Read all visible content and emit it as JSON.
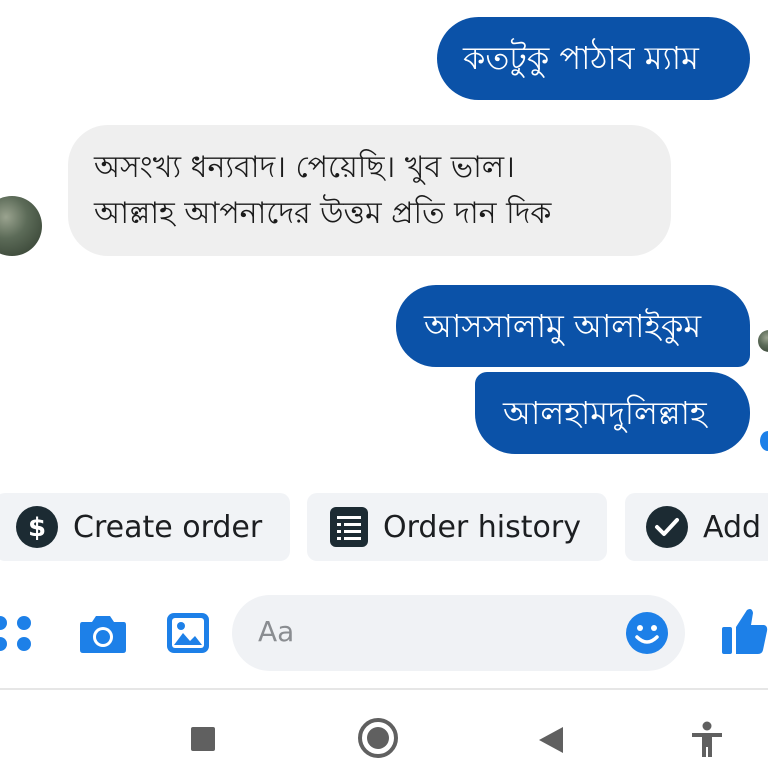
{
  "messages": [
    {
      "id": "m1",
      "side": "outgoing",
      "text": "কতটুকু পাঠাব ম্যাম"
    },
    {
      "id": "m2",
      "side": "incoming",
      "lines": [
        "অসংখ্য ধন্যবাদ। পেয়েছি। খুব ভাল।",
        "আল্লাহ আপনাদের উত্তম প্রতি দান  দিক"
      ]
    },
    {
      "id": "m3",
      "side": "outgoing",
      "text": "আসসালামু আলাইকুম"
    },
    {
      "id": "m4",
      "side": "outgoing",
      "text": "আলহামদুলিল্লাহ"
    }
  ],
  "quick_actions": [
    {
      "label": "Create order",
      "icon": "dollar-circle-icon"
    },
    {
      "label": "Order history",
      "icon": "document-list-icon"
    },
    {
      "label": "Add",
      "icon": "check-circle-icon"
    }
  ],
  "composer": {
    "placeholder": "Aa",
    "tools": [
      "apps-grid-icon",
      "camera-icon",
      "gallery-icon"
    ],
    "emoji_icon": "emoji-icon",
    "send_icon": "thumbs-up-icon"
  },
  "nav_bar": [
    "recents-square-icon",
    "home-circle-icon",
    "back-triangle-icon",
    "accessibility-icon"
  ],
  "colors": {
    "outgoing_bubble": "#0b52a8",
    "incoming_bubble": "#efefef",
    "accent": "#1877f2",
    "chip_bg": "#f1f3f6"
  }
}
